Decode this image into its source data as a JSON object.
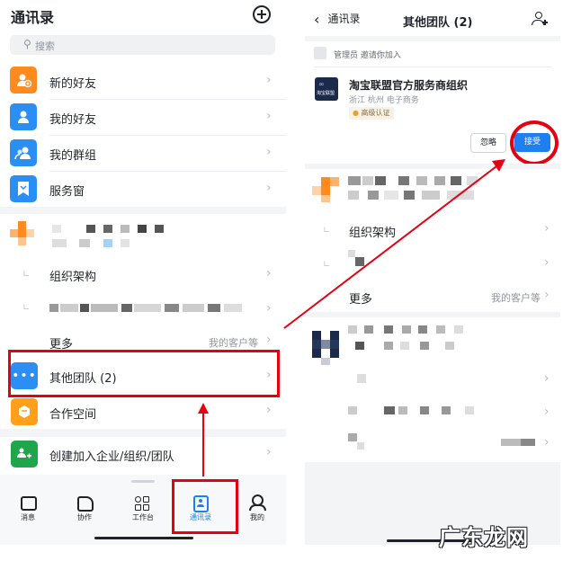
{
  "left": {
    "header": {
      "title": "通讯录",
      "add_icon": "plus-circle-icon"
    },
    "search": {
      "placeholder": "搜索",
      "icon": "search-icon"
    },
    "menu": [
      {
        "label": "新的好友",
        "icon": "add-user-icon",
        "color": "#ff8a1e"
      },
      {
        "label": "我的好友",
        "icon": "user-icon",
        "color": "#2b8ef3"
      },
      {
        "label": "我的群组",
        "icon": "group-icon",
        "color": "#2b8ef3"
      },
      {
        "label": "服务窗",
        "icon": "bookmark-icon",
        "color": "#2b8ef3"
      }
    ],
    "org": {
      "structure_label": "组织架构",
      "more_label": "更多",
      "more_value": "我的客户等"
    },
    "other_teams_label": "其他团队 (2)",
    "coop_label": "合作空间",
    "create_label": "创建加入企业/组织/团队",
    "tabs": [
      {
        "label": "消息",
        "icon": "message-icon"
      },
      {
        "label": "协作",
        "icon": "collaborate-icon"
      },
      {
        "label": "工作台",
        "icon": "workbench-icon"
      },
      {
        "label": "通讯录",
        "icon": "contacts-icon",
        "active": true
      },
      {
        "label": "我的",
        "icon": "profile-icon"
      }
    ]
  },
  "right": {
    "header": {
      "back_label": "通讯录",
      "title": "其他团队 (2)",
      "add_icon": "add-group-icon"
    },
    "invite": {
      "text": "管理员 邀请你加入",
      "org_name": "淘宝联盟官方服务商组织",
      "org_meta": "浙江 杭州 电子商务",
      "badge": "高级认证",
      "logo_text": "淘宝联盟",
      "ignore_label": "忽略",
      "accept_label": "接受"
    },
    "org": {
      "structure_label": "组织架构",
      "more_label": "更多",
      "more_value": "我的客户等"
    }
  },
  "watermark": "广东龙网",
  "colors": {
    "accent": "#1e7ff0",
    "highlight": "#e60012",
    "orange": "#ff8a1e"
  }
}
